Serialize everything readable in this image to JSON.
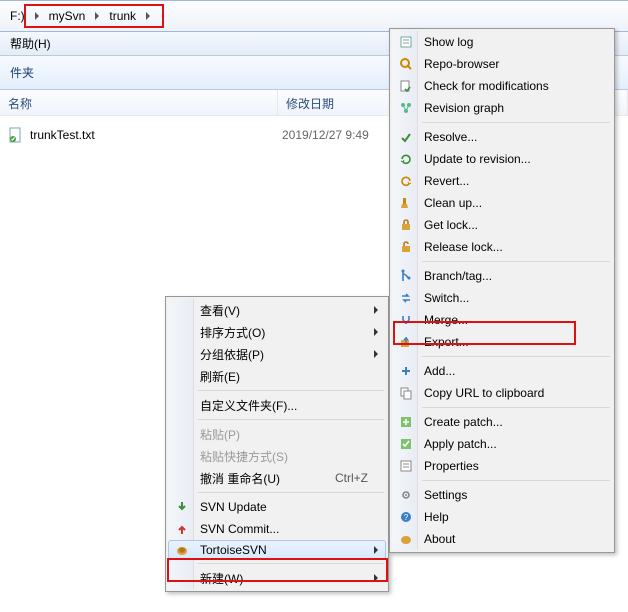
{
  "breadcrumb": {
    "drive": "F:)",
    "seg1": "mySvn",
    "seg2": "trunk"
  },
  "menubar": {
    "help": "帮助(H)"
  },
  "toolbar": {
    "folders": "件夹"
  },
  "list": {
    "col_name": "名称",
    "col_date": "修改日期",
    "row0": {
      "name": "trunkTest.txt",
      "date": "2019/12/27 9:49"
    }
  },
  "ctx1": {
    "view": "查看(V)",
    "sort": "排序方式(O)",
    "group": "分组依据(P)",
    "refresh": "刷新(E)",
    "customize": "自定义文件夹(F)...",
    "paste": "粘贴(P)",
    "paste_shortcut": "粘贴快捷方式(S)",
    "undo_rename": "撤消 重命名(U)",
    "undo_key": "Ctrl+Z",
    "svn_update": "SVN Update",
    "svn_commit": "SVN Commit...",
    "tortoise": "TortoiseSVN",
    "new": "新建(W)"
  },
  "ctx2": {
    "show_log": "Show log",
    "repo_browser": "Repo-browser",
    "check_mod": "Check for modifications",
    "rev_graph": "Revision graph",
    "resolve": "Resolve...",
    "update_rev": "Update to revision...",
    "revert": "Revert...",
    "cleanup": "Clean up...",
    "get_lock": "Get lock...",
    "release_lock": "Release lock...",
    "branch_tag": "Branch/tag...",
    "switch": "Switch...",
    "merge": "Merge...",
    "export": "Export...",
    "add": "Add...",
    "copy_url": "Copy URL to clipboard",
    "create_patch": "Create patch...",
    "apply_patch": "Apply patch...",
    "properties": "Properties",
    "settings": "Settings",
    "help": "Help",
    "about": "About"
  }
}
